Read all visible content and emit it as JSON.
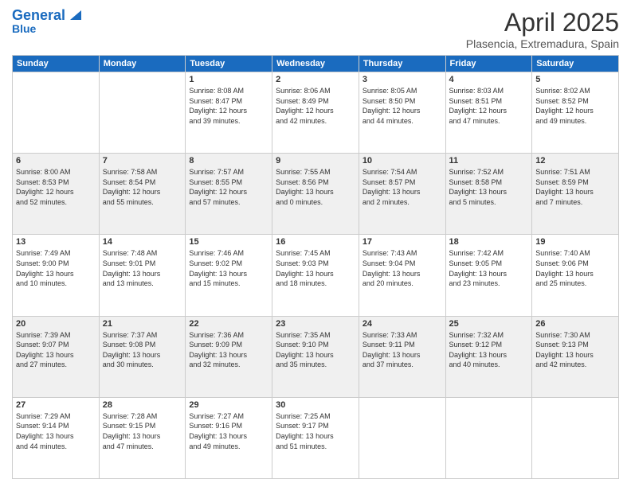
{
  "header": {
    "logo_general": "General",
    "logo_blue": "Blue",
    "title": "April 2025",
    "subtitle": "Plasencia, Extremadura, Spain"
  },
  "columns": [
    "Sunday",
    "Monday",
    "Tuesday",
    "Wednesday",
    "Thursday",
    "Friday",
    "Saturday"
  ],
  "weeks": [
    {
      "days": [
        {
          "num": "",
          "info": ""
        },
        {
          "num": "",
          "info": ""
        },
        {
          "num": "1",
          "info": "Sunrise: 8:08 AM\nSunset: 8:47 PM\nDaylight: 12 hours\nand 39 minutes."
        },
        {
          "num": "2",
          "info": "Sunrise: 8:06 AM\nSunset: 8:49 PM\nDaylight: 12 hours\nand 42 minutes."
        },
        {
          "num": "3",
          "info": "Sunrise: 8:05 AM\nSunset: 8:50 PM\nDaylight: 12 hours\nand 44 minutes."
        },
        {
          "num": "4",
          "info": "Sunrise: 8:03 AM\nSunset: 8:51 PM\nDaylight: 12 hours\nand 47 minutes."
        },
        {
          "num": "5",
          "info": "Sunrise: 8:02 AM\nSunset: 8:52 PM\nDaylight: 12 hours\nand 49 minutes."
        }
      ]
    },
    {
      "days": [
        {
          "num": "6",
          "info": "Sunrise: 8:00 AM\nSunset: 8:53 PM\nDaylight: 12 hours\nand 52 minutes."
        },
        {
          "num": "7",
          "info": "Sunrise: 7:58 AM\nSunset: 8:54 PM\nDaylight: 12 hours\nand 55 minutes."
        },
        {
          "num": "8",
          "info": "Sunrise: 7:57 AM\nSunset: 8:55 PM\nDaylight: 12 hours\nand 57 minutes."
        },
        {
          "num": "9",
          "info": "Sunrise: 7:55 AM\nSunset: 8:56 PM\nDaylight: 13 hours\nand 0 minutes."
        },
        {
          "num": "10",
          "info": "Sunrise: 7:54 AM\nSunset: 8:57 PM\nDaylight: 13 hours\nand 2 minutes."
        },
        {
          "num": "11",
          "info": "Sunrise: 7:52 AM\nSunset: 8:58 PM\nDaylight: 13 hours\nand 5 minutes."
        },
        {
          "num": "12",
          "info": "Sunrise: 7:51 AM\nSunset: 8:59 PM\nDaylight: 13 hours\nand 7 minutes."
        }
      ]
    },
    {
      "days": [
        {
          "num": "13",
          "info": "Sunrise: 7:49 AM\nSunset: 9:00 PM\nDaylight: 13 hours\nand 10 minutes."
        },
        {
          "num": "14",
          "info": "Sunrise: 7:48 AM\nSunset: 9:01 PM\nDaylight: 13 hours\nand 13 minutes."
        },
        {
          "num": "15",
          "info": "Sunrise: 7:46 AM\nSunset: 9:02 PM\nDaylight: 13 hours\nand 15 minutes."
        },
        {
          "num": "16",
          "info": "Sunrise: 7:45 AM\nSunset: 9:03 PM\nDaylight: 13 hours\nand 18 minutes."
        },
        {
          "num": "17",
          "info": "Sunrise: 7:43 AM\nSunset: 9:04 PM\nDaylight: 13 hours\nand 20 minutes."
        },
        {
          "num": "18",
          "info": "Sunrise: 7:42 AM\nSunset: 9:05 PM\nDaylight: 13 hours\nand 23 minutes."
        },
        {
          "num": "19",
          "info": "Sunrise: 7:40 AM\nSunset: 9:06 PM\nDaylight: 13 hours\nand 25 minutes."
        }
      ]
    },
    {
      "days": [
        {
          "num": "20",
          "info": "Sunrise: 7:39 AM\nSunset: 9:07 PM\nDaylight: 13 hours\nand 27 minutes."
        },
        {
          "num": "21",
          "info": "Sunrise: 7:37 AM\nSunset: 9:08 PM\nDaylight: 13 hours\nand 30 minutes."
        },
        {
          "num": "22",
          "info": "Sunrise: 7:36 AM\nSunset: 9:09 PM\nDaylight: 13 hours\nand 32 minutes."
        },
        {
          "num": "23",
          "info": "Sunrise: 7:35 AM\nSunset: 9:10 PM\nDaylight: 13 hours\nand 35 minutes."
        },
        {
          "num": "24",
          "info": "Sunrise: 7:33 AM\nSunset: 9:11 PM\nDaylight: 13 hours\nand 37 minutes."
        },
        {
          "num": "25",
          "info": "Sunrise: 7:32 AM\nSunset: 9:12 PM\nDaylight: 13 hours\nand 40 minutes."
        },
        {
          "num": "26",
          "info": "Sunrise: 7:30 AM\nSunset: 9:13 PM\nDaylight: 13 hours\nand 42 minutes."
        }
      ]
    },
    {
      "days": [
        {
          "num": "27",
          "info": "Sunrise: 7:29 AM\nSunset: 9:14 PM\nDaylight: 13 hours\nand 44 minutes."
        },
        {
          "num": "28",
          "info": "Sunrise: 7:28 AM\nSunset: 9:15 PM\nDaylight: 13 hours\nand 47 minutes."
        },
        {
          "num": "29",
          "info": "Sunrise: 7:27 AM\nSunset: 9:16 PM\nDaylight: 13 hours\nand 49 minutes."
        },
        {
          "num": "30",
          "info": "Sunrise: 7:25 AM\nSunset: 9:17 PM\nDaylight: 13 hours\nand 51 minutes."
        },
        {
          "num": "",
          "info": ""
        },
        {
          "num": "",
          "info": ""
        },
        {
          "num": "",
          "info": ""
        }
      ]
    }
  ]
}
